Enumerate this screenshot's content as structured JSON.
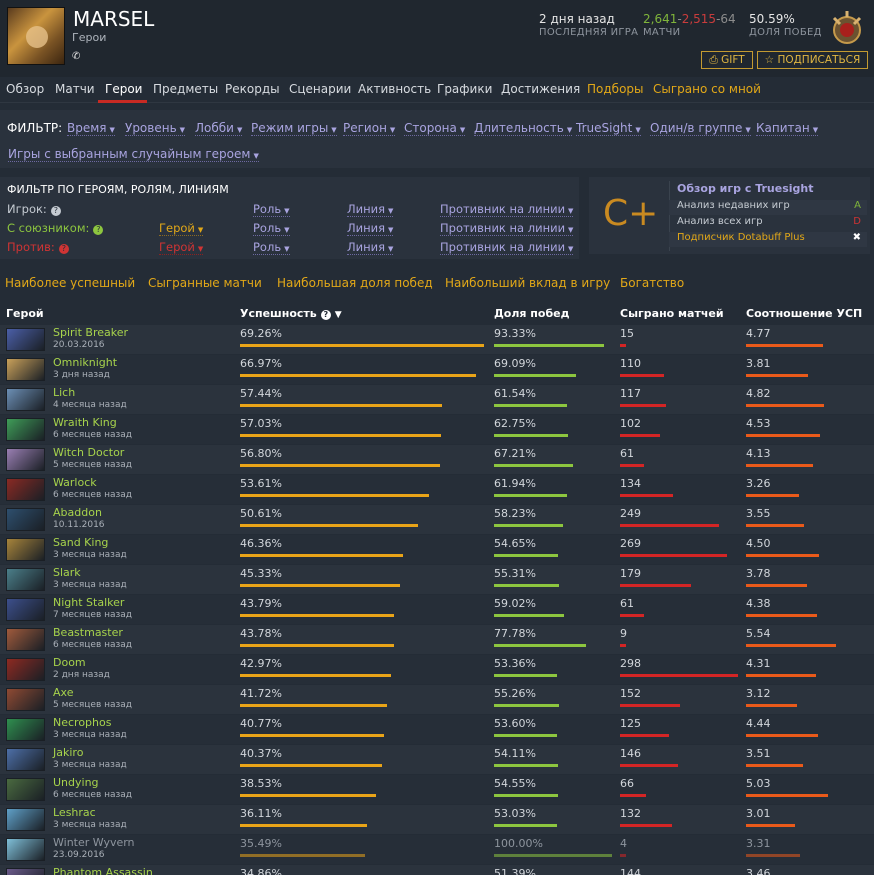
{
  "player": {
    "name": "MARSEL",
    "subtitle": "Герои"
  },
  "header_stats": {
    "last_game_value": "2 дня назад",
    "last_game_label": "ПОСЛЕДНЯЯ ИГРА",
    "wins": "2,641",
    "sep1": "-",
    "losses": "2,515",
    "sep2": "-",
    "abandons": "64",
    "matches_label": "МАТЧИ",
    "winrate_value": "50.59%",
    "winrate_label": "ДОЛЯ ПОБЕД"
  },
  "buttons": {
    "gift": "GIFT",
    "subscribe": "ПОДПИСАТЬСЯ"
  },
  "nav": [
    "Обзор",
    "Матчи",
    "Герои",
    "Предметы",
    "Рекорды",
    "Сценарии",
    "Активность",
    "Графики",
    "Достижения",
    "Подборы",
    "Сыграно со мной"
  ],
  "filters": {
    "label": "ФИЛЬТР:",
    "items": [
      "Время",
      "Уровень",
      "Лобби",
      "Режим игры",
      "Регион",
      "Сторона",
      "Длительность",
      "TrueSight",
      "Один/в группе",
      "Капитан",
      "Игры с выбранным случайным героем"
    ]
  },
  "hero_filter": {
    "title": "ФИЛЬТР ПО ГЕРОЯМ, РОЛЯМ, ЛИНИЯМ",
    "player_label": "Игрок:",
    "ally_label": "С союзником:",
    "enemy_label": "Против:",
    "hero": "Герой",
    "role": "Роль",
    "lane": "Линия",
    "lane_opponent": "Противник на линии"
  },
  "truesight": {
    "grade": "C+",
    "title": "Обзор игр с Truesight",
    "rows": [
      {
        "label": "Анализ недавних игр",
        "value": "A"
      },
      {
        "label": "Анализ всех игр",
        "value": "D"
      },
      {
        "label": "Подписчик Dotabuff Plus",
        "value": "✖"
      }
    ]
  },
  "tabs": [
    "Наиболее успешный",
    "Сыгранные матчи",
    "Наибольшая доля побед",
    "Наибольший вклад в игру",
    "Богатство"
  ],
  "table": {
    "headers": {
      "hero": "Герой",
      "success": "Успешность",
      "winrate": "Доля побед",
      "played": "Сыграно матчей",
      "kda": "Соотношение УСП"
    },
    "rows": [
      {
        "hero": "Spirit Breaker",
        "date": "20.03.2016",
        "success": "69.26%",
        "winrate": "93.33%",
        "played": "15",
        "kda": "4.77"
      },
      {
        "hero": "Omniknight",
        "date": "3 дня назад",
        "success": "66.97%",
        "winrate": "69.09%",
        "played": "110",
        "kda": "3.81"
      },
      {
        "hero": "Lich",
        "date": "4 месяца назад",
        "success": "57.44%",
        "winrate": "61.54%",
        "played": "117",
        "kda": "4.82"
      },
      {
        "hero": "Wraith King",
        "date": "6 месяцев назад",
        "success": "57.03%",
        "winrate": "62.75%",
        "played": "102",
        "kda": "4.53"
      },
      {
        "hero": "Witch Doctor",
        "date": "5 месяцев назад",
        "success": "56.80%",
        "winrate": "67.21%",
        "played": "61",
        "kda": "4.13"
      },
      {
        "hero": "Warlock",
        "date": "6 месяцев назад",
        "success": "53.61%",
        "winrate": "61.94%",
        "played": "134",
        "kda": "3.26"
      },
      {
        "hero": "Abaddon",
        "date": "10.11.2016",
        "success": "50.61%",
        "winrate": "58.23%",
        "played": "249",
        "kda": "3.55"
      },
      {
        "hero": "Sand King",
        "date": "3 месяца назад",
        "success": "46.36%",
        "winrate": "54.65%",
        "played": "269",
        "kda": "4.50"
      },
      {
        "hero": "Slark",
        "date": "3 месяца назад",
        "success": "45.33%",
        "winrate": "55.31%",
        "played": "179",
        "kda": "3.78"
      },
      {
        "hero": "Night Stalker",
        "date": "7 месяцев назад",
        "success": "43.79%",
        "winrate": "59.02%",
        "played": "61",
        "kda": "4.38"
      },
      {
        "hero": "Beastmaster",
        "date": "6 месяцев назад",
        "success": "43.78%",
        "winrate": "77.78%",
        "played": "9",
        "kda": "5.54"
      },
      {
        "hero": "Doom",
        "date": "2 дня назад",
        "success": "42.97%",
        "winrate": "53.36%",
        "played": "298",
        "kda": "4.31"
      },
      {
        "hero": "Axe",
        "date": "5 месяцев назад",
        "success": "41.72%",
        "winrate": "55.26%",
        "played": "152",
        "kda": "3.12"
      },
      {
        "hero": "Necrophos",
        "date": "3 месяца назад",
        "success": "40.77%",
        "winrate": "53.60%",
        "played": "125",
        "kda": "4.44"
      },
      {
        "hero": "Jakiro",
        "date": "3 месяца назад",
        "success": "40.37%",
        "winrate": "54.11%",
        "played": "146",
        "kda": "3.51"
      },
      {
        "hero": "Undying",
        "date": "6 месяцев назад",
        "success": "38.53%",
        "winrate": "54.55%",
        "played": "66",
        "kda": "5.03"
      },
      {
        "hero": "Leshrac",
        "date": "3 месяца назад",
        "success": "36.11%",
        "winrate": "53.03%",
        "played": "132",
        "kda": "3.01"
      },
      {
        "hero": "Winter Wyvern",
        "date": "23.09.2016",
        "success": "35.49%",
        "winrate": "100.00%",
        "played": "4",
        "kda": "3.31",
        "dim": true
      },
      {
        "hero": "Phantom Assassin",
        "date": "",
        "success": "34.86%",
        "winrate": "51.39%",
        "played": "144",
        "kda": "3.46"
      }
    ]
  },
  "colors": {
    "success_bar": "#e9a418",
    "winrate_bar": "#8dc63f",
    "played_bar": "#d42525",
    "kda_bar": "#ea5a1a",
    "hero_link": "#a7d34c",
    "accent_gold": "#e2a818",
    "filter_link": "#a9a4e0"
  },
  "icons": {
    "phone": "phone-icon",
    "medal": "rank-medal-icon",
    "gift": "gift-icon",
    "star": "star-icon",
    "help": "help-icon",
    "sort": "sort-desc-icon"
  }
}
